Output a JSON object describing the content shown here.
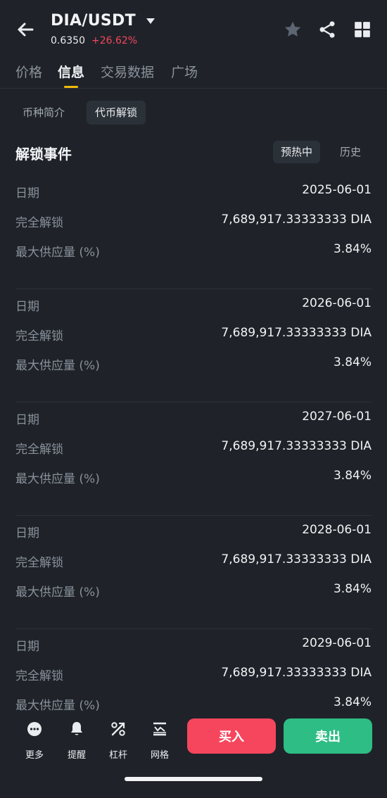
{
  "header": {
    "pair": "DIA/USDT",
    "price": "0.6350",
    "change": "+26.62%"
  },
  "tabs": [
    {
      "label": "价格"
    },
    {
      "label": "信息"
    },
    {
      "label": "交易数据"
    },
    {
      "label": "广场"
    }
  ],
  "subtabs": [
    {
      "label": "币种简介"
    },
    {
      "label": "代币解锁"
    }
  ],
  "section": {
    "title": "解锁事件",
    "filters": [
      {
        "label": "预热中"
      },
      {
        "label": "历史"
      }
    ]
  },
  "labels": {
    "date": "日期",
    "full_unlock": "完全解锁",
    "max_supply": "最大供应量 (%)"
  },
  "events": [
    {
      "date": "2025-06-01",
      "amount": "7,689,917.33333333 DIA",
      "pct": "3.84%"
    },
    {
      "date": "2026-06-01",
      "amount": "7,689,917.33333333 DIA",
      "pct": "3.84%"
    },
    {
      "date": "2027-06-01",
      "amount": "7,689,917.33333333 DIA",
      "pct": "3.84%"
    },
    {
      "date": "2028-06-01",
      "amount": "7,689,917.33333333 DIA",
      "pct": "3.84%"
    },
    {
      "date": "2029-06-01",
      "amount": "7,689,917.33333333 DIA",
      "pct": "3.84%"
    }
  ],
  "bottom": {
    "items": [
      {
        "label": "更多"
      },
      {
        "label": "提醒"
      },
      {
        "label": "杠杆"
      },
      {
        "label": "网格"
      }
    ],
    "buy": "买入",
    "sell": "卖出"
  },
  "colors": {
    "background": "#1f2329",
    "accent": "#f0b90b",
    "up": "#2ebd85",
    "down": "#f6465d"
  }
}
